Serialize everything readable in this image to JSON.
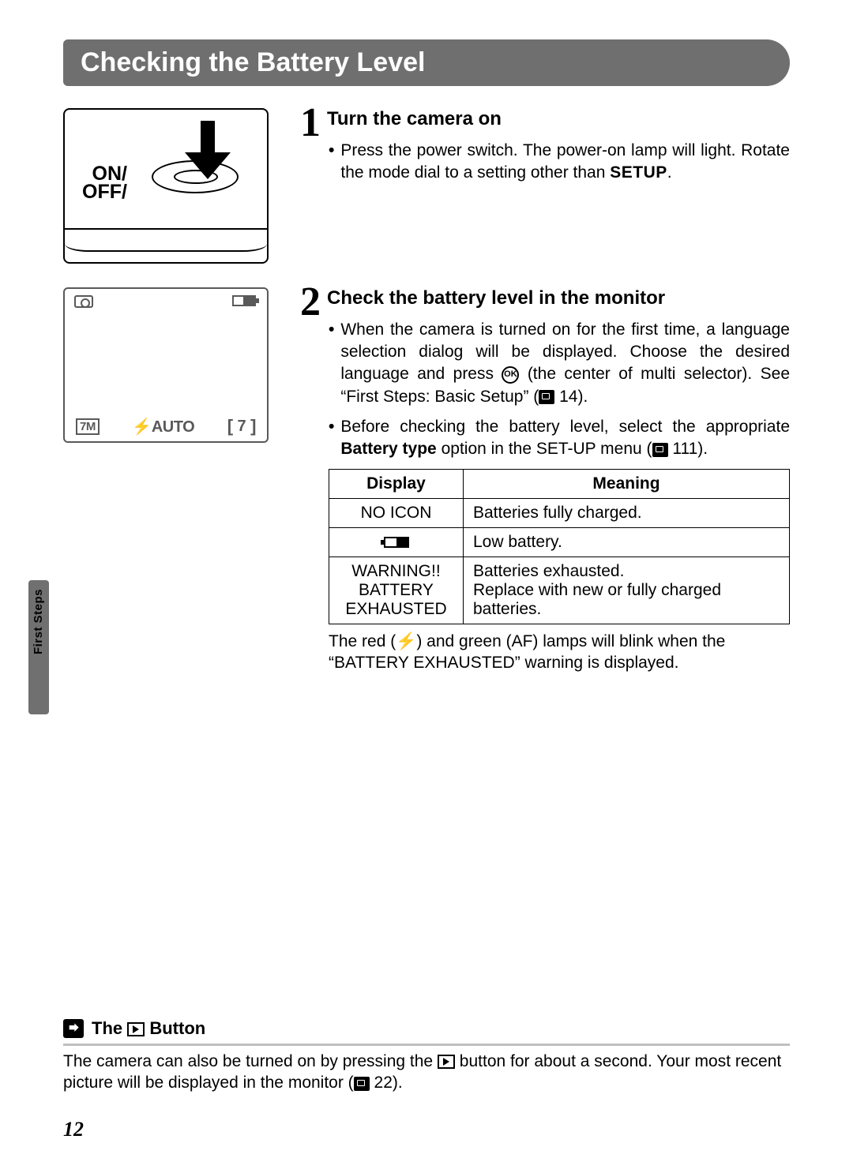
{
  "title": "Checking the Battery Level",
  "side_tab": "First Steps",
  "step1": {
    "num": "1",
    "title": "Turn the camera on",
    "bullet1_a": "Press the power switch. The power-on lamp will light. Rotate the mode dial to a setting other than ",
    "bullet1_setup": "SETUP",
    "bullet1_b": "."
  },
  "illus1": {
    "on": "ON",
    "off": "OFF"
  },
  "illus2": {
    "sevenm": "7M",
    "auto": "⚡AUTO",
    "count": "7"
  },
  "step2": {
    "num": "2",
    "title": "Check the battery level in the monitor",
    "bullet1_a": "When the camera is turned on for the first time, a language selection dialog will be displayed. Choose the desired language and press ",
    "bullet1_b": " (the center of multi selector). See “First Steps: Basic Setup” (",
    "bullet1_c": " 14).",
    "bullet2_a": "Before checking the battery level, select the appropriate ",
    "bullet2_bold": "Battery type",
    "bullet2_b": " option in the SET-UP menu (",
    "bullet2_c": " 111)."
  },
  "table": {
    "head_display": "Display",
    "head_meaning": "Meaning",
    "rows": [
      {
        "display": "NO ICON",
        "meaning": "Batteries fully charged."
      },
      {
        "display": "__LOWBATT__",
        "meaning": "Low battery."
      },
      {
        "display": "WARNING!!\nBATTERY\nEXHAUSTED",
        "meaning": "Batteries exhausted.\nReplace with new or fully charged batteries."
      }
    ]
  },
  "table_note_a": "The red (",
  "table_note_bolt": "⚡",
  "table_note_b": ") and green (AF) lamps will blink when the “BATTERY EXHAUSTED” warning is displayed.",
  "footer": {
    "heading_a": "The ",
    "heading_b": " Button",
    "body_a": "The camera can also be turned on by pressing the ",
    "body_b": " button for about a second. Your most recent picture will be displayed in the monitor (",
    "body_c": " 22)."
  },
  "page_number": "12"
}
